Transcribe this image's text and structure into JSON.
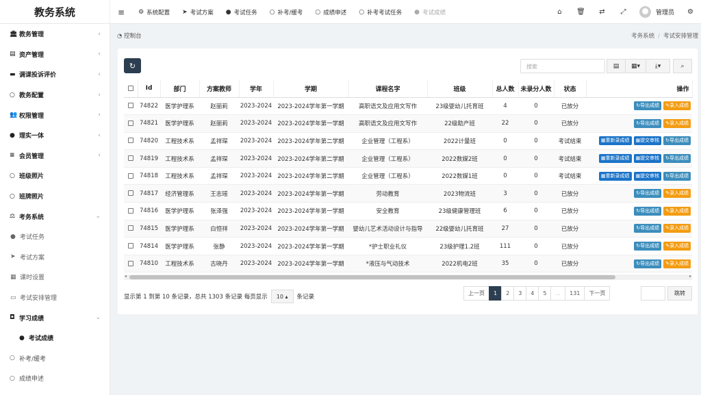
{
  "app": {
    "title": "教务系统"
  },
  "topnav": [
    {
      "icon": "gear-icon",
      "glyph": "⚙",
      "label": "系统配置",
      "dim": false
    },
    {
      "icon": "send-icon",
      "glyph": "➤",
      "label": "考试方案",
      "dim": false
    },
    {
      "icon": "check-circle-icon",
      "glyph": "●",
      "label": "考试任务",
      "dim": false
    },
    {
      "icon": "circle-icon",
      "glyph": "○",
      "label": "补考/缓考",
      "dim": false
    },
    {
      "icon": "circle-icon",
      "glyph": "○",
      "label": "成绩申述",
      "dim": false
    },
    {
      "icon": "circle-icon",
      "glyph": "○",
      "label": "补考考试任务",
      "dim": false
    },
    {
      "icon": "check-circle-icon",
      "glyph": "●",
      "label": "考试成绩",
      "dim": true
    }
  ],
  "user": {
    "name": "管理员"
  },
  "sidebar": [
    {
      "icon": "bank-icon",
      "glyph": "🏛",
      "label": "教务管理",
      "type": "top",
      "arrow": "‹"
    },
    {
      "icon": "book-icon",
      "glyph": "▤",
      "label": "资产管理",
      "type": "top",
      "arrow": "‹"
    },
    {
      "icon": "bed-icon",
      "glyph": "▬",
      "label": "调课投诉评价",
      "type": "top",
      "arrow": "‹"
    },
    {
      "icon": "circle-icon",
      "glyph": "○",
      "label": "教务配置",
      "type": "top",
      "arrow": "‹"
    },
    {
      "icon": "users-icon",
      "glyph": "👥",
      "label": "权限管理",
      "type": "top",
      "arrow": "‹"
    },
    {
      "icon": "check-circle-icon",
      "glyph": "●",
      "label": "理实一体",
      "type": "top",
      "arrow": "‹"
    },
    {
      "icon": "list-icon",
      "glyph": "≡",
      "label": "会员管理",
      "type": "top",
      "arrow": "‹"
    },
    {
      "icon": "circle-icon",
      "glyph": "○",
      "label": "班级照片",
      "type": "top",
      "arrow": ""
    },
    {
      "icon": "circle-icon",
      "glyph": "○",
      "label": "班牌照片",
      "type": "top",
      "arrow": ""
    },
    {
      "icon": "balance-icon",
      "glyph": "⚖",
      "label": "考务系统",
      "type": "top",
      "arrow": "⌄"
    },
    {
      "icon": "check-circle-icon",
      "glyph": "●",
      "label": "考试任务",
      "type": "sub",
      "arrow": ""
    },
    {
      "icon": "send-icon",
      "glyph": "➤",
      "label": "考试方案",
      "type": "sub",
      "arrow": ""
    },
    {
      "icon": "calendar-icon",
      "glyph": "▦",
      "label": "课时设置",
      "type": "sub",
      "arrow": ""
    },
    {
      "icon": "keyboard-icon",
      "glyph": "▭",
      "label": "考试安排管理",
      "type": "sub",
      "arrow": ""
    },
    {
      "icon": "square-icon",
      "glyph": "◘",
      "label": "学习成绩",
      "type": "top",
      "arrow": "⌄"
    },
    {
      "icon": "check-circle-icon",
      "glyph": "●",
      "label": "考试成绩",
      "type": "sub2",
      "arrow": ""
    },
    {
      "icon": "circle-icon",
      "glyph": "○",
      "label": "补考/缓考",
      "type": "plain",
      "arrow": ""
    },
    {
      "icon": "circle-icon",
      "glyph": "○",
      "label": "成绩申述",
      "type": "plain",
      "arrow": ""
    }
  ],
  "breadcrumb": {
    "left": "控制台",
    "items": [
      "考务系统",
      "考试安排管理"
    ]
  },
  "toolbar": {
    "search_placeholder": "搜索"
  },
  "table": {
    "headers": [
      "Id",
      "部门",
      "方案教师",
      "学年",
      "学期",
      "课程名字",
      "班级",
      "总人数",
      "未录分人数",
      "状态",
      "操作"
    ],
    "rows": [
      {
        "id": "74822",
        "dept": "医学护理系",
        "teacher": "赵丽莉",
        "year": "2023-2024",
        "term": "2023-2024学年第一学期",
        "course": "高职语文及应用文写作",
        "class": "23级婴幼儿托育班",
        "total": "4",
        "unscored": "0",
        "status": "已放分",
        "ops": "normal"
      },
      {
        "id": "74821",
        "dept": "医学护理系",
        "teacher": "赵丽莉",
        "year": "2023-2024",
        "term": "2023-2024学年第一学期",
        "course": "高职语文及应用文写作",
        "class": "22级助产班",
        "total": "22",
        "unscored": "0",
        "status": "已放分",
        "ops": "normal"
      },
      {
        "id": "74820",
        "dept": "工程技术系",
        "teacher": "孟祥琛",
        "year": "2023-2024",
        "term": "2023-2024学年第二学期",
        "course": "企业管理（工程系）",
        "class": "2022计量班",
        "total": "0",
        "unscored": "0",
        "status": "考试结束",
        "ops": "ended"
      },
      {
        "id": "74819",
        "dept": "工程技术系",
        "teacher": "孟祥琛",
        "year": "2023-2024",
        "term": "2023-2024学年第二学期",
        "course": "企业管理（工程系）",
        "class": "2022数媒2班",
        "total": "0",
        "unscored": "0",
        "status": "考试结束",
        "ops": "ended"
      },
      {
        "id": "74818",
        "dept": "工程技术系",
        "teacher": "孟祥琛",
        "year": "2023-2024",
        "term": "2023-2024学年第二学期",
        "course": "企业管理（工程系）",
        "class": "2022数媒1班",
        "total": "0",
        "unscored": "0",
        "status": "考试结束",
        "ops": "ended"
      },
      {
        "id": "74817",
        "dept": "经济管理系",
        "teacher": "王志瑶",
        "year": "2023-2024",
        "term": "2023-2024学年第一学期",
        "course": "劳动教育",
        "class": "2023物流班",
        "total": "3",
        "unscored": "0",
        "status": "已放分",
        "ops": "normal"
      },
      {
        "id": "74816",
        "dept": "医学护理系",
        "teacher": "张泽强",
        "year": "2023-2024",
        "term": "2023-2024学年第一学期",
        "course": "安全教育",
        "class": "23级健康管理班",
        "total": "6",
        "unscored": "0",
        "status": "已放分",
        "ops": "normal"
      },
      {
        "id": "74815",
        "dept": "医学护理系",
        "teacher": "白恒祥",
        "year": "2023-2024",
        "term": "2023-2024学年第一学期",
        "course": "婴幼儿艺术活动设计与指导",
        "class": "22级婴幼儿托育班",
        "total": "27",
        "unscored": "0",
        "status": "已放分",
        "ops": "normal"
      },
      {
        "id": "74814",
        "dept": "医学护理系",
        "teacher": "张静",
        "year": "2023-2024",
        "term": "2023-2024学年第一学期",
        "course": "*护士职业礼仪",
        "class": "23级护理1.2班",
        "total": "111",
        "unscored": "0",
        "status": "已放分",
        "ops": "normal"
      },
      {
        "id": "74810",
        "dept": "工程技术系",
        "teacher": "古晓丹",
        "year": "2023-2024",
        "term": "2023-2024学年第一学期",
        "course": "*液压与气动技术",
        "class": "2022机电2班",
        "total": "35",
        "unscored": "0",
        "status": "已放分",
        "ops": "normal"
      }
    ],
    "op_labels": {
      "export": "导出成绩",
      "enter": "录入成绩",
      "reenter": "重新录成绩",
      "submit": "提交审核"
    }
  },
  "pagination": {
    "info": "显示第 1 到第 10 条记录，总共 1303 条记录 每页显示",
    "page_size": "10",
    "suffix": "条记录",
    "prev": "上一页",
    "pages": [
      "1",
      "2",
      "3",
      "4",
      "5",
      "...",
      "131"
    ],
    "next": "下一页",
    "jump": "跳转"
  },
  "colors": {
    "primary": "#2c3e50",
    "blue": "#3c8dbc",
    "orange": "#f39c12"
  }
}
